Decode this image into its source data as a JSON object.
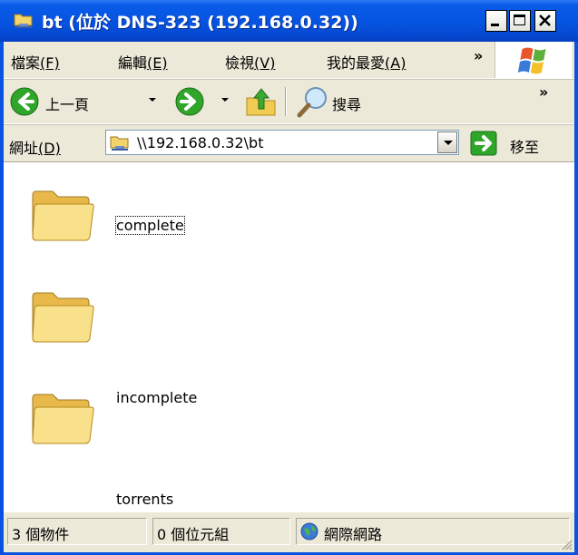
{
  "window": {
    "title": "bt (位於 DNS-323 (192.168.0.32))",
    "title_icon": "network-folder-icon"
  },
  "menu": {
    "items": [
      {
        "label": "檔案",
        "mnemonic": "(F)"
      },
      {
        "label": "編輯",
        "mnemonic": "(E)"
      },
      {
        "label": "檢視",
        "mnemonic": "(V)"
      },
      {
        "label": "我的最愛",
        "mnemonic": "(A)"
      }
    ],
    "overflow": "»"
  },
  "toolbar": {
    "back_label": "上一頁",
    "search_label": "搜尋",
    "overflow": "»"
  },
  "address": {
    "label": "網址",
    "mnemonic": "(D)",
    "value": "\\\\192.168.0.32\\bt",
    "go_label": "移至"
  },
  "folders": [
    {
      "name": "complete"
    },
    {
      "name": "incomplete"
    },
    {
      "name": "torrents"
    }
  ],
  "status": {
    "objects": "3 個物件",
    "size": "0 個位元組",
    "zone": "網際網路"
  },
  "colors": {
    "titlebar": "#0653e0",
    "chrome": "#ece9d8",
    "folder": "#f6d978"
  }
}
